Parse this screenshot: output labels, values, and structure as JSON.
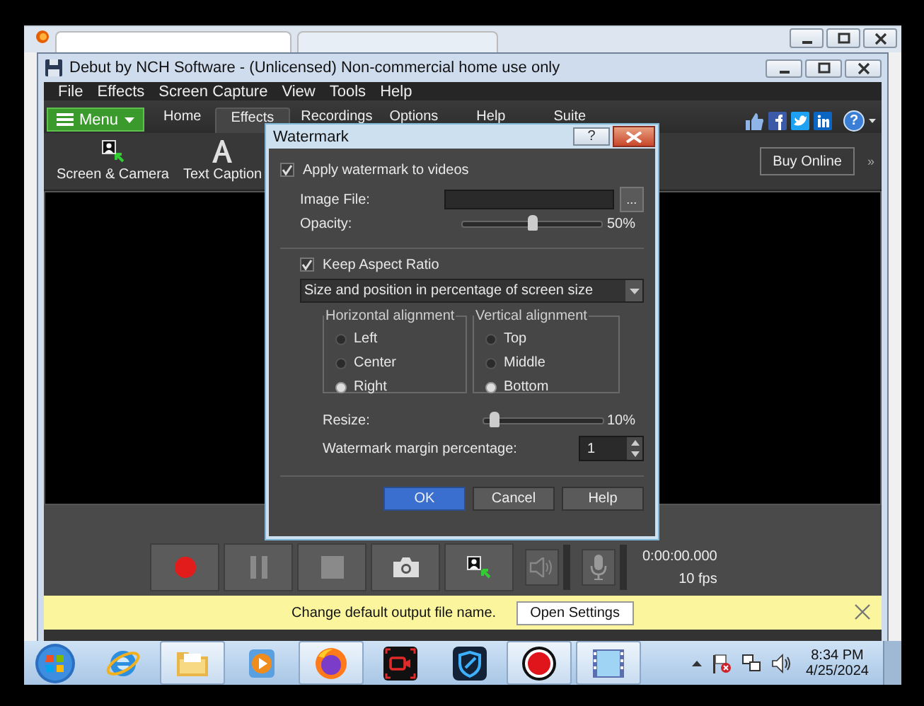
{
  "window": {
    "title": "Debut by NCH Software - (Unlicensed) Non-commercial home use only"
  },
  "menu": [
    "File",
    "Effects",
    "Screen Capture",
    "View",
    "Tools",
    "Help"
  ],
  "ribbon": {
    "menu_button": "Menu",
    "tabs": [
      {
        "label": "Home",
        "selected": false
      },
      {
        "label": "Effects",
        "selected": true
      },
      {
        "label": "Recordings",
        "selected": false
      },
      {
        "label": "Options",
        "selected": false
      },
      {
        "label": "Help",
        "selected": false
      },
      {
        "label": "Suite",
        "selected": false
      }
    ],
    "help_glyph": "?"
  },
  "toolbar": [
    {
      "label": "Screen & Camera",
      "kind": "screen-camera"
    },
    {
      "label": "Text Caption",
      "kind": "caption"
    }
  ],
  "buy_button": "Buy Online",
  "more": "»",
  "controls": {
    "buttons": [
      {
        "kind": "record"
      },
      {
        "kind": "pause"
      },
      {
        "kind": "stop"
      },
      {
        "kind": "snapshot"
      },
      {
        "kind": "screen-camera"
      }
    ],
    "timer": "0:00:00.000",
    "fps": "10 fps"
  },
  "notice": {
    "text": "Change default output file name.",
    "button": "Open Settings"
  },
  "dialog": {
    "title": "Watermark",
    "help_glyph": "?",
    "apply": {
      "label": "Apply watermark to videos",
      "checked": true
    },
    "image_file": {
      "label": "Image File:",
      "browse": "..."
    },
    "opacity": {
      "label": "Opacity:",
      "level": 0.5,
      "reading": "50%"
    },
    "keep_aspect": {
      "label": "Keep Aspect Ratio",
      "checked": true
    },
    "mode": "Size and position in percentage of screen size",
    "groups": [
      {
        "title": "Horizontal alignment",
        "options": [
          {
            "label": "Left",
            "selected": false
          },
          {
            "label": "Center",
            "selected": false
          },
          {
            "label": "Right",
            "selected": true
          }
        ]
      },
      {
        "title": "Vertical alignment",
        "options": [
          {
            "label": "Top",
            "selected": false
          },
          {
            "label": "Middle",
            "selected": false
          },
          {
            "label": "Bottom",
            "selected": true
          }
        ]
      }
    ],
    "resize": {
      "label": "Resize:",
      "level": 0.08,
      "reading": "10%"
    },
    "margin": {
      "label": "Watermark margin percentage:",
      "value": "1"
    },
    "buttons": [
      {
        "label": "OK",
        "kind": "primary"
      },
      {
        "label": "Cancel",
        "kind": "normal"
      },
      {
        "label": "Help",
        "kind": "normal"
      }
    ]
  },
  "taskbar": {
    "apps": [
      {
        "kind": "ie",
        "active": false
      },
      {
        "kind": "folder",
        "active": true
      },
      {
        "kind": "media",
        "active": false
      },
      {
        "kind": "firefox",
        "active": true
      },
      {
        "kind": "recorder",
        "active": false
      },
      {
        "kind": "shield",
        "active": false
      },
      {
        "kind": "record",
        "active": true
      },
      {
        "kind": "film",
        "active": true
      }
    ],
    "time": "8:34 PM",
    "date": "4/25/2024"
  }
}
